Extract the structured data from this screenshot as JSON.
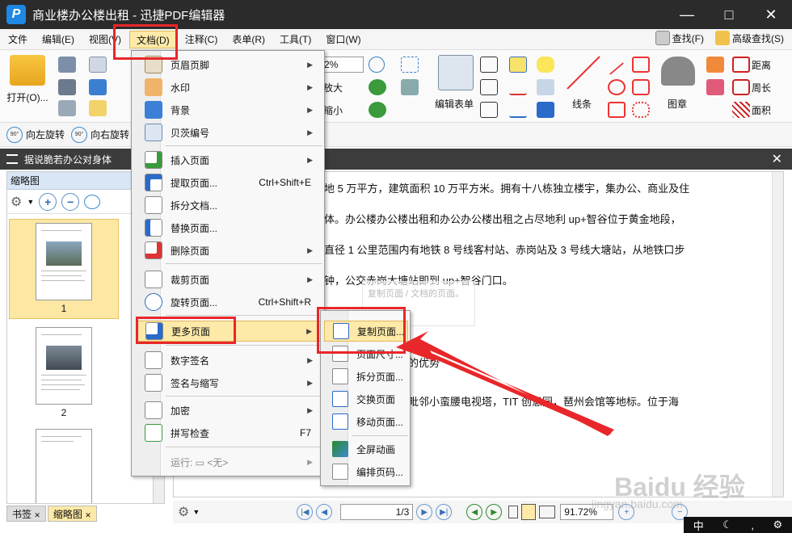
{
  "window": {
    "title": "商业楼办公楼出租 - 迅捷PDF编辑器",
    "logo": "P"
  },
  "menubar": {
    "items": [
      "文件",
      "编辑(E)",
      "视图(V)",
      "文档(D)",
      "注释(C)",
      "表单(R)",
      "工具(T)",
      "窗口(W)"
    ],
    "find": "查找(F)",
    "advanced_find": "高级查找(S)"
  },
  "toolbar": {
    "open": "打开(O)...",
    "zoom_value": "2%",
    "zoom_in": "放大",
    "zoom_out": "缩小",
    "edit_form": "编辑表单",
    "line": "线条",
    "stamp": "图章",
    "distance": "距离",
    "perimeter": "周长",
    "area": "面积"
  },
  "rotate": {
    "left": "向左旋转",
    "right": "向右旋转",
    "left_deg": "90°",
    "right_deg": "90°"
  },
  "doc_tab": {
    "title": "据说脆若办公对身体"
  },
  "left_panel": {
    "title": "缩略图",
    "thumbs": [
      {
        "num": "1"
      },
      {
        "num": "2"
      },
      {
        "num": ""
      }
    ],
    "tabs": [
      "书签",
      "缩略图"
    ]
  },
  "document": {
    "lines": [
      "地 5 万平方，建筑面积 10 万平方米。拥有十八栋独立楼宇，集办公、商业及住",
      "体。办公楼办公楼出租和办公办公楼出租之占尽地利 up+智谷位于黄金地段，",
      "直径 1 公里范围内有地铁 8 号线客村站、赤岗站及 3 号线大塘站，从地铁口步",
      "钟，公交赤岗大塘站即到 up+智谷门口。",
      "的优势",
      "毗邻小蛮腰电视塔，TIT 创意园，琶州会馆等地标。位于海"
    ],
    "tip": "复制页面 / 文档的页面。"
  },
  "doc_menu": {
    "items": [
      {
        "label": "页眉页脚",
        "shortcut": "",
        "arrow": true,
        "icon": "header-footer-icon"
      },
      {
        "label": "水印",
        "shortcut": "",
        "arrow": true,
        "icon": "watermark-icon"
      },
      {
        "label": "背景",
        "shortcut": "",
        "arrow": true,
        "icon": "background-icon"
      },
      {
        "label": "贝茨编号",
        "shortcut": "",
        "arrow": true,
        "icon": "bates-number-icon"
      },
      {
        "label": "插入页面",
        "shortcut": "",
        "arrow": true,
        "icon": "insert-page-icon"
      },
      {
        "label": "提取页面...",
        "shortcut": "Ctrl+Shift+E",
        "arrow": false,
        "icon": "extract-page-icon"
      },
      {
        "label": "拆分文档...",
        "shortcut": "",
        "arrow": false,
        "icon": "split-document-icon"
      },
      {
        "label": "替换页面...",
        "shortcut": "",
        "arrow": false,
        "icon": "replace-page-icon"
      },
      {
        "label": "删除页面",
        "shortcut": "",
        "arrow": true,
        "icon": "delete-page-icon"
      },
      {
        "label": "裁剪页面",
        "shortcut": "",
        "arrow": true,
        "icon": "crop-page-icon"
      },
      {
        "label": "旋转页面...",
        "shortcut": "Ctrl+Shift+R",
        "arrow": false,
        "icon": "rotate-page-icon"
      },
      {
        "label": "更多页面",
        "shortcut": "",
        "arrow": true,
        "icon": "more-pages-icon"
      },
      {
        "label": "数字签名",
        "shortcut": "",
        "arrow": true,
        "icon": "digital-signature-icon"
      },
      {
        "label": "签名与缩写",
        "shortcut": "",
        "arrow": true,
        "icon": "sign-initials-icon"
      },
      {
        "label": "加密",
        "shortcut": "",
        "arrow": true,
        "icon": "encrypt-icon"
      },
      {
        "label": "拼写检查",
        "shortcut": "F7",
        "arrow": false,
        "icon": "spell-check-icon"
      },
      {
        "label": "运行: ▭ <无>",
        "shortcut": "",
        "arrow": true,
        "icon": ""
      }
    ]
  },
  "sub_menu": {
    "items": [
      "复制页面...",
      "页面尺寸...",
      "拆分页面...",
      "交换页面",
      "移动页面...",
      "全屏动画",
      "编排页码..."
    ]
  },
  "status": {
    "page": "1/3",
    "zoom": "91.72%"
  },
  "ime": {
    "mode": "中"
  },
  "watermark": {
    "text": "Baidu 经验",
    "url": "jingyan.baidu.com"
  },
  "colors": {
    "highlight": "#fde9a8",
    "annotation_red": "#e8272a",
    "titlebar": "#2b2b2b"
  }
}
